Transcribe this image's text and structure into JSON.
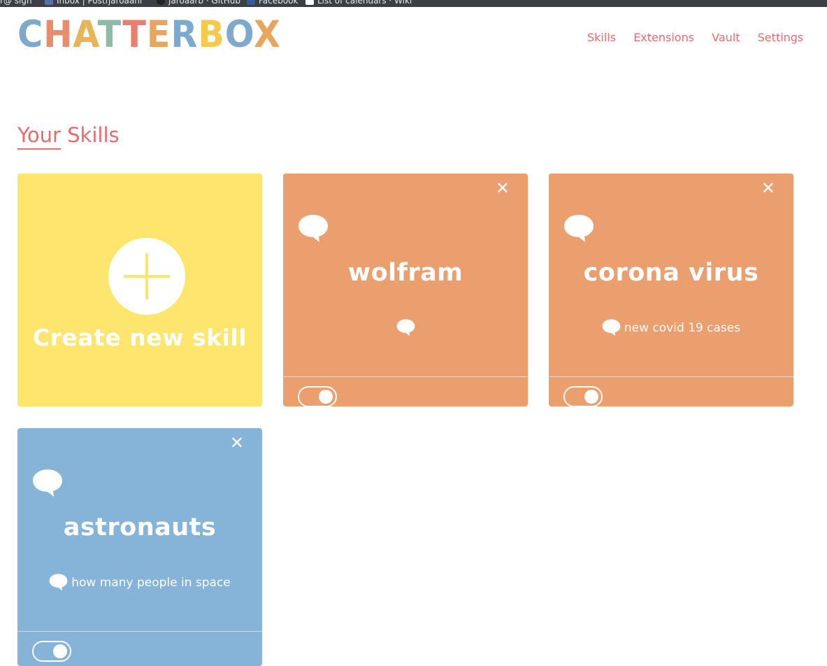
{
  "browser": {
    "bookmarks": [
      {
        "label": "r@ sign",
        "icon": "bookmark-icon"
      },
      {
        "label": "Inbox | Postfjaroaahl",
        "icon": "mail-icon"
      },
      {
        "label": "jaroaarb · GitHub",
        "icon": "github-icon"
      },
      {
        "label": "Facebook",
        "icon": "facebook-icon"
      },
      {
        "label": "List of calendars · Wiki",
        "icon": "wiki-icon"
      }
    ]
  },
  "logo": {
    "text": "CHATTERBOX",
    "letter_colors": [
      "#7fa8cf",
      "#e88c6a",
      "#e8b45a",
      "#8fb9a8",
      "#e87e6b",
      "#e8a55e",
      "#7aaad0",
      "#f5c84e",
      "#7fa8cf",
      "#e8a55e"
    ]
  },
  "nav": {
    "items": [
      "Skills",
      "Extensions",
      "Vault",
      "Settings"
    ]
  },
  "heading": {
    "underlined": "Your",
    "rest": " Skills"
  },
  "create_card": {
    "label": "Create new skill",
    "color": "#fee56d",
    "plus_color": "#fee56d",
    "icon": "plus-icon"
  },
  "skills": [
    {
      "name": "wolfram",
      "phrase": "",
      "color": "#eb9f6e",
      "enabled": true,
      "close": "✕"
    },
    {
      "name": "corona virus",
      "phrase": "new covid 19 cases",
      "color": "#eb9f6e",
      "enabled": true,
      "close": "✕"
    },
    {
      "name": "astronauts",
      "phrase": "how many people in space",
      "color": "#86b3d8",
      "enabled": true,
      "close": "✕"
    }
  ]
}
